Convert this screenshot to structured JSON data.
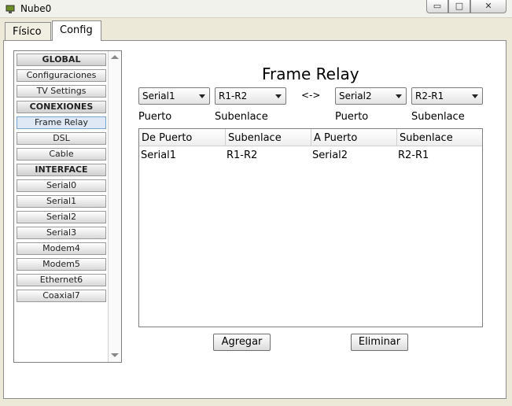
{
  "window": {
    "title": "Nube0"
  },
  "tabs": [
    {
      "label": "Físico"
    },
    {
      "label": "Config"
    }
  ],
  "sidebar": {
    "items": [
      {
        "label": "GLOBAL"
      },
      {
        "label": "Configuraciones"
      },
      {
        "label": "TV Settings"
      },
      {
        "label": "CONEXIONES"
      },
      {
        "label": "Frame Relay"
      },
      {
        "label": "DSL"
      },
      {
        "label": "Cable"
      },
      {
        "label": "INTERFACE"
      },
      {
        "label": "Serial0"
      },
      {
        "label": "Serial1"
      },
      {
        "label": "Serial2"
      },
      {
        "label": "Serial3"
      },
      {
        "label": "Modem4"
      },
      {
        "label": "Modem5"
      },
      {
        "label": "Ethernet6"
      },
      {
        "label": "Coaxial7"
      }
    ]
  },
  "main": {
    "title": "Frame Relay",
    "from_port": "Serial1",
    "from_sublink": "R1-R2",
    "separator": "<->",
    "to_port": "Serial2",
    "to_sublink": "R2-R1",
    "labels": {
      "puerto1": "Puerto",
      "subenlace1": "Subenlace",
      "puerto2": "Puerto",
      "subenlace2": "Subenlace"
    },
    "table": {
      "headers": [
        "De Puerto",
        "Subenlace",
        "A Puerto",
        "Subenlace"
      ],
      "rows": [
        [
          "Serial1",
          "R1-R2",
          "Serial2",
          "R2-R1"
        ]
      ]
    },
    "buttons": {
      "add": "Agregar",
      "remove": "Eliminar"
    }
  }
}
